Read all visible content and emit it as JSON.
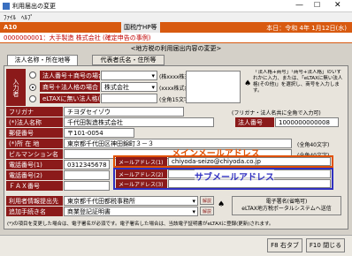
{
  "window": {
    "title": "利用届出の変更",
    "menu_file": "ﾌｧｲﾙ",
    "menu_help": "ﾍﾙﾌﾟ"
  },
  "header": {
    "code": "A10",
    "org": "国税庁HP等",
    "date": "本日：令和 4年 1月12日(水)"
  },
  "case_line": "0000000001：大手製造  株式会社  (確定申告の事例)",
  "banner_title": "<地方税の利用届出内容の変更>",
  "tabs": [
    "法人名称・所在地等",
    "代表者氏名・住所等"
  ],
  "rows": {
    "type_label": "入力者",
    "r1_label": "法人番号＋商号の場合",
    "r1_note": "(株xxxx株式会社)",
    "r2_label": "商号＋法人格の場合",
    "r2_value": "株式会社",
    "r2_note": "(xxxx株式会社)",
    "r3_label": "eLTAXに無い法人格(その他)",
    "r3_note": "(全角15文字)",
    "side_note": "「法人格+商号」「商号+法人格」のいずれかに入力、または、「eLTAXに無い法人格(その他)」を選択し、商号を入力します。",
    "kana_label": "フリガナ",
    "kana_value": "チヨダセイゾウ",
    "kana_note": "(フリガナ・法人名共に全角で入力可)",
    "name_label": "法人名称",
    "name_value": "千代田製造株式会社",
    "corpno_label": "法人番号",
    "corpno_value": "1000000000008",
    "zip_label": "郵便番号",
    "zip_value": "〒101-0054",
    "addr_label": "所 在 地",
    "addr_value": "東京都千代田区神田錦町３－３",
    "addr_note": "(全角40文字)",
    "bldg_label": "ビルマンション名",
    "bldg_note": "(全角40文字)",
    "tel1_label": "電話番号(1)",
    "tel1_value": "0312345678",
    "tel2_label": "電話番号(2)",
    "fax_label": "ＦＡＸ番号",
    "mail1_label": "メールアドレス(1)",
    "mail1_value": "chiyoda-seizo@chiyoda.co.jp",
    "mail2_label": "メールアドレス(2)",
    "mail3_label": "メールアドレス(3)",
    "main_mail_caption": "メインメールアドレス",
    "sub_mail_caption": "サブメールアドレス",
    "office_label": "利用者情報提出先",
    "office_value": "東京都千代田都税事務所",
    "svc_label": "追加手続き名",
    "svc_value": "商業登記証明書",
    "explain": "解説",
    "sig_title": "電子署名(省略可)",
    "sig_sub": "eLTAX地方税ポータルシステムへ送信",
    "foot_note": "(*)の項目を変更した場合は、電子署名が必須です。電子署名した場合は、当該電子証明書がeLTAXに登録(更新)されます。"
  },
  "footer": {
    "f8": "F8 右タブ",
    "f10": "F10 閉じる"
  }
}
